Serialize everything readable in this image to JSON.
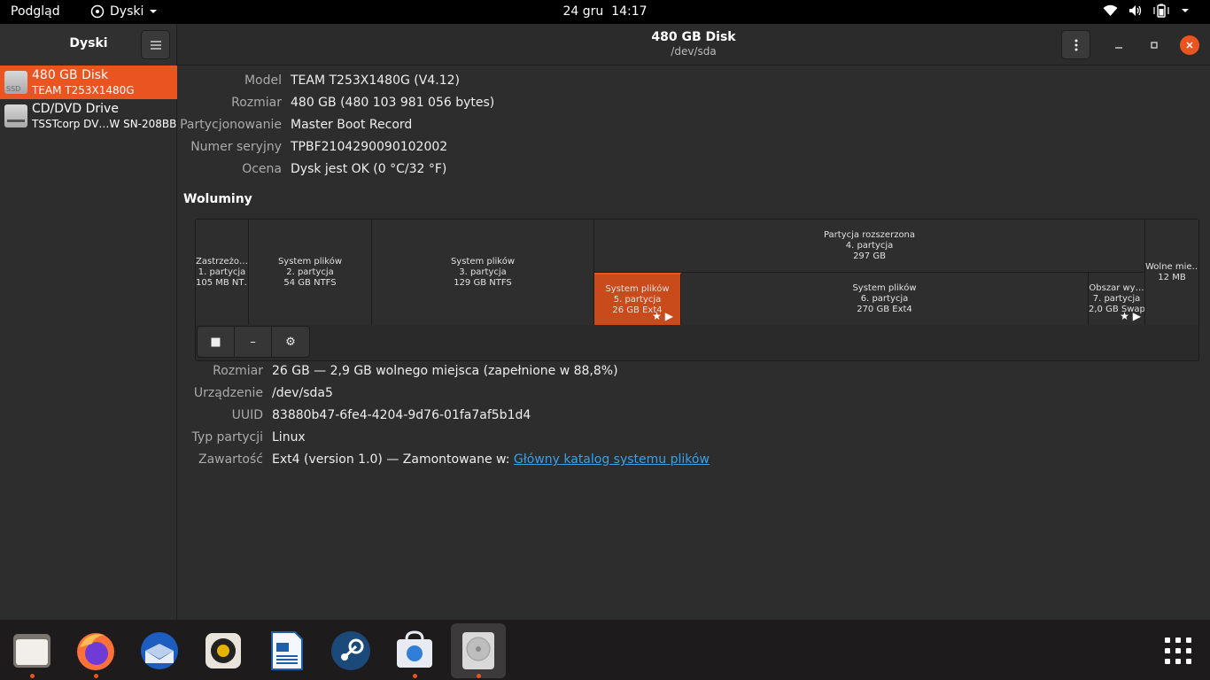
{
  "topbar": {
    "activities": "Podgląd",
    "app_name": "Dyski",
    "date": "24 gru",
    "time": "14:17",
    "tray_icons": [
      "wifi-icon",
      "volume-icon",
      "battery-icon",
      "power-menu-icon"
    ]
  },
  "sidebar": {
    "title": "Dyski",
    "drives": [
      {
        "name": "480 GB Disk",
        "model": "TEAM T253X1480G",
        "badge": "SSD",
        "selected": true
      },
      {
        "name": "CD/DVD Drive",
        "model": "TSSTcorp DV…W SN-208BB",
        "badge": "",
        "selected": false
      }
    ]
  },
  "header": {
    "title": "480 GB Disk",
    "subtitle": "/dev/sda"
  },
  "disk_props": [
    {
      "key": "Model",
      "value": "TEAM T253X1480G (V4.12)"
    },
    {
      "key": "Rozmiar",
      "value": "480 GB (480 103 981 056 bytes)"
    },
    {
      "key": "Partycjonowanie",
      "value": "Master Boot Record"
    },
    {
      "key": "Numer seryjny",
      "value": "TPBF2104290090102002"
    },
    {
      "key": "Ocena",
      "value": "Dysk jest OK (0 °C/32 °F)"
    }
  ],
  "volumes_title": "Woluminy",
  "partitions": {
    "p1": {
      "l1": "Zastrzeżo…",
      "l2": "1. partycja",
      "l3": "105 MB NT…"
    },
    "p2": {
      "l1": "System plików",
      "l2": "2. partycja",
      "l3": "54 GB NTFS"
    },
    "p3": {
      "l1": "System plików",
      "l2": "3. partycja",
      "l3": "129 GB NTFS"
    },
    "p4": {
      "l1": "Partycja rozszerzona",
      "l2": "4. partycja",
      "l3": "297 GB"
    },
    "p5": {
      "l1": "System plików",
      "l2": "5. partycja",
      "l3": "26 GB Ext4"
    },
    "p6": {
      "l1": "System plików",
      "l2": "6. partycja",
      "l3": "270 GB Ext4"
    },
    "p7": {
      "l1": "Obszar wy…",
      "l2": "7. partycja",
      "l3": "2,0 GB Swap"
    },
    "free": {
      "l1": "Wolne mie…",
      "l2": "12 MB"
    }
  },
  "vol_props": [
    {
      "key": "Rozmiar",
      "value": "26 GB — 2,9 GB wolnego miejsca (zapełnione w 88,8%)"
    },
    {
      "key": "Urządzenie",
      "value": "/dev/sda5"
    },
    {
      "key": "UUID",
      "value": "83880b47-6fe4-4204-9d76-01fa7af5b1d4"
    },
    {
      "key": "Typ partycji",
      "value": "Linux"
    },
    {
      "key": "Zawartość",
      "value": "Ext4 (version 1.0) — Zamontowane w: ",
      "link": "Główny katalog systemu plików"
    }
  ],
  "dock": [
    {
      "name": "files-icon",
      "running": true
    },
    {
      "name": "firefox-icon",
      "running": true
    },
    {
      "name": "thunderbird-icon",
      "running": false
    },
    {
      "name": "rhythmbox-icon",
      "running": false
    },
    {
      "name": "libreoffice-writer-icon",
      "running": false
    },
    {
      "name": "steam-icon",
      "running": false
    },
    {
      "name": "software-center-icon",
      "running": true
    },
    {
      "name": "disks-icon",
      "running": true
    },
    {
      "name": "show-apps-icon",
      "running": false
    }
  ],
  "colors": {
    "accent": "#e95420",
    "link": "#3aa0e4"
  }
}
